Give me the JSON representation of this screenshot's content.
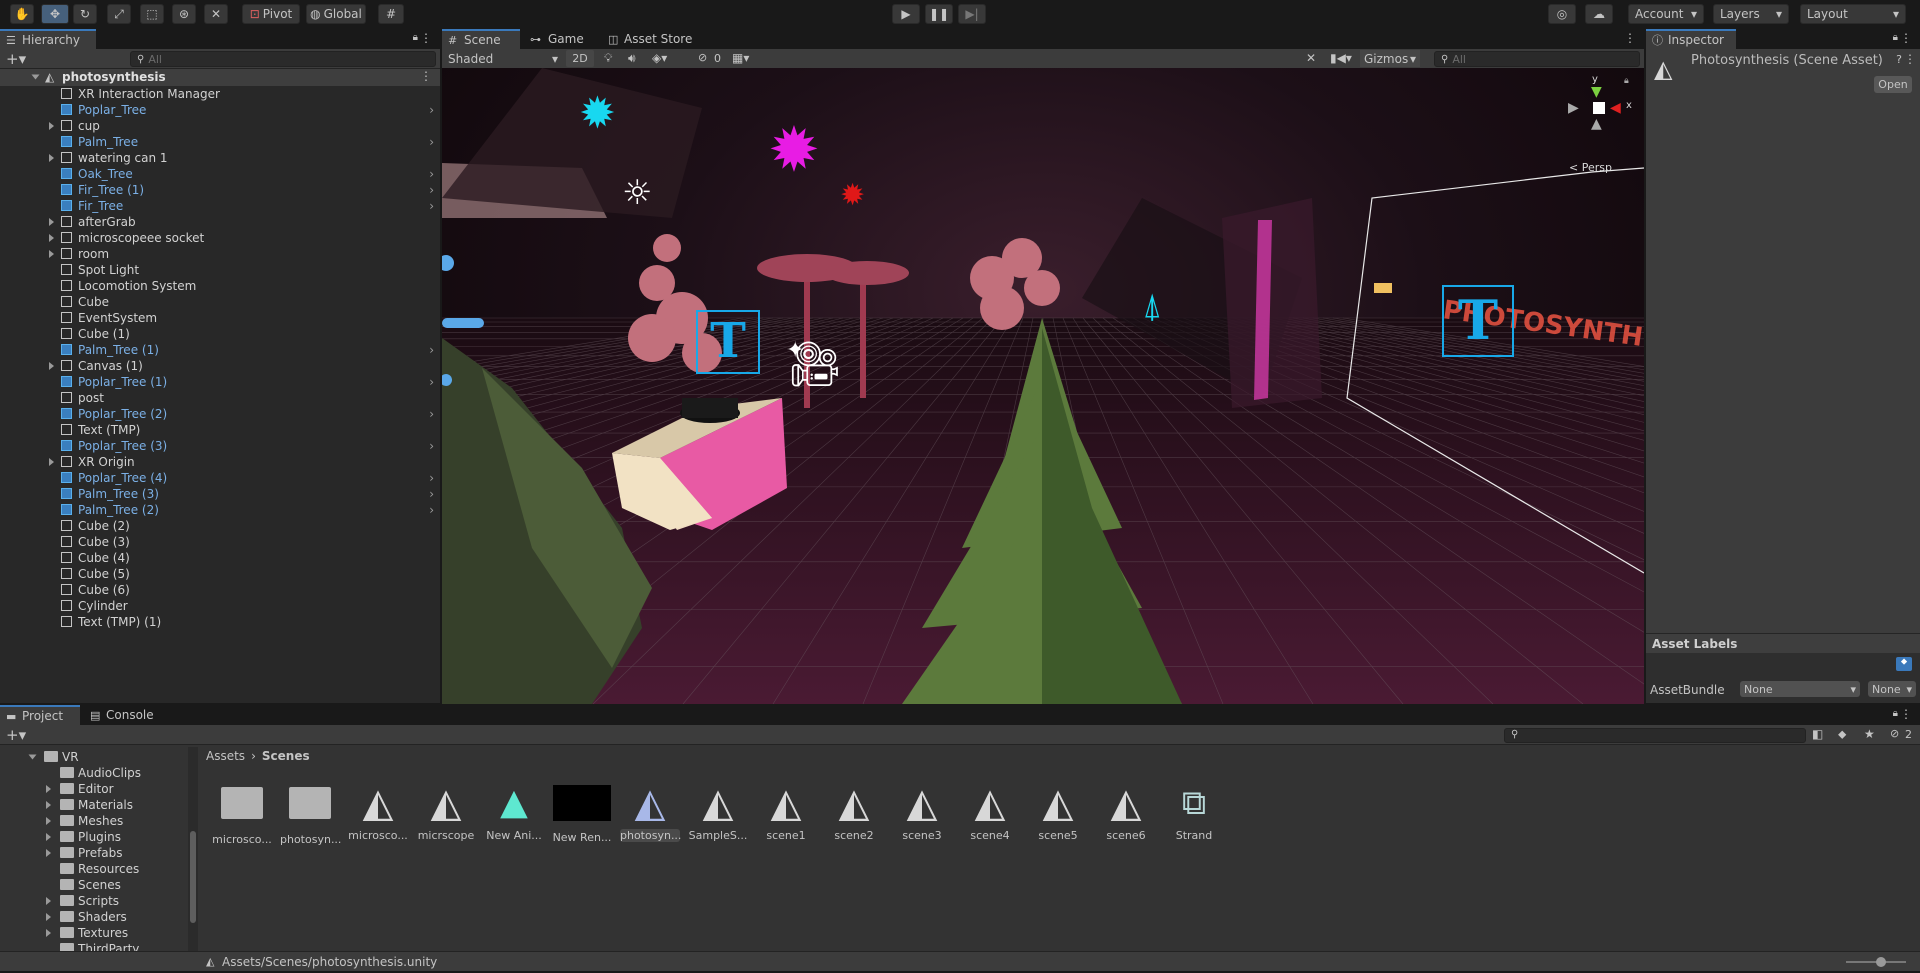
{
  "toolbar": {
    "pivot": "Pivot",
    "global": "Global",
    "account": "Account",
    "layers": "Layers",
    "layout": "Layout"
  },
  "hierarchy": {
    "tab": "Hierarchy",
    "search_placeholder": "All",
    "scene_name": "photosynthesis",
    "items": [
      {
        "label": "XR Interaction Manager",
        "prefab": false,
        "expand": false,
        "arrow": false
      },
      {
        "label": "Poplar_Tree",
        "prefab": true,
        "expand": false,
        "arrow": true
      },
      {
        "label": "cup",
        "prefab": false,
        "expand": true,
        "arrow": false
      },
      {
        "label": "Palm_Tree",
        "prefab": true,
        "expand": false,
        "arrow": true
      },
      {
        "label": "watering can 1",
        "prefab": false,
        "expand": true,
        "arrow": false
      },
      {
        "label": "Oak_Tree",
        "prefab": true,
        "expand": false,
        "arrow": true
      },
      {
        "label": "Fir_Tree (1)",
        "prefab": true,
        "expand": false,
        "arrow": true
      },
      {
        "label": "Fir_Tree",
        "prefab": true,
        "expand": false,
        "arrow": true
      },
      {
        "label": "afterGrab",
        "prefab": false,
        "expand": true,
        "arrow": false
      },
      {
        "label": "microscopeee socket",
        "prefab": false,
        "expand": true,
        "arrow": false
      },
      {
        "label": "room",
        "prefab": false,
        "expand": true,
        "arrow": false
      },
      {
        "label": "Spot Light",
        "prefab": false,
        "expand": false,
        "arrow": false
      },
      {
        "label": "Locomotion System",
        "prefab": false,
        "expand": false,
        "arrow": false
      },
      {
        "label": "Cube",
        "prefab": false,
        "expand": false,
        "arrow": false
      },
      {
        "label": "EventSystem",
        "prefab": false,
        "expand": false,
        "arrow": false
      },
      {
        "label": "Cube (1)",
        "prefab": false,
        "expand": false,
        "arrow": false
      },
      {
        "label": "Palm_Tree (1)",
        "prefab": true,
        "expand": false,
        "arrow": true
      },
      {
        "label": "Canvas (1)",
        "prefab": false,
        "expand": true,
        "arrow": false
      },
      {
        "label": "Poplar_Tree (1)",
        "prefab": true,
        "expand": false,
        "arrow": true
      },
      {
        "label": "post",
        "prefab": false,
        "expand": false,
        "arrow": false
      },
      {
        "label": "Poplar_Tree (2)",
        "prefab": true,
        "expand": false,
        "arrow": true
      },
      {
        "label": "Text (TMP)",
        "prefab": false,
        "expand": false,
        "arrow": false
      },
      {
        "label": "Poplar_Tree (3)",
        "prefab": true,
        "expand": false,
        "arrow": true
      },
      {
        "label": "XR Origin",
        "prefab": false,
        "expand": true,
        "arrow": false
      },
      {
        "label": "Poplar_Tree (4)",
        "prefab": true,
        "expand": false,
        "arrow": true
      },
      {
        "label": "Palm_Tree (3)",
        "prefab": true,
        "expand": false,
        "arrow": true
      },
      {
        "label": "Palm_Tree (2)",
        "prefab": true,
        "expand": false,
        "arrow": true
      },
      {
        "label": "Cube (2)",
        "prefab": false,
        "expand": false,
        "arrow": false
      },
      {
        "label": "Cube (3)",
        "prefab": false,
        "expand": false,
        "arrow": false
      },
      {
        "label": "Cube (4)",
        "prefab": false,
        "expand": false,
        "arrow": false
      },
      {
        "label": "Cube (5)",
        "prefab": false,
        "expand": false,
        "arrow": false
      },
      {
        "label": "Cube (6)",
        "prefab": false,
        "expand": false,
        "arrow": false
      },
      {
        "label": "Cylinder",
        "prefab": false,
        "expand": false,
        "arrow": false
      },
      {
        "label": "Text (TMP) (1)",
        "prefab": false,
        "expand": false,
        "arrow": false
      }
    ]
  },
  "scene_view": {
    "tabs": [
      "Scene",
      "Game",
      "Asset Store"
    ],
    "shading": "Shaded",
    "mode_2d": "2D",
    "hidden_count": "0",
    "gizmos": "Gizmos",
    "search_placeholder": "All",
    "persp": "< Persp",
    "axis_y": "y",
    "axis_x": "x",
    "sign_text": "PHOTOSYNTHESIS",
    "text_icon": "T"
  },
  "inspector": {
    "tab": "Inspector",
    "title": "Photosynthesis (Scene Asset)",
    "open": "Open",
    "asset_labels": "Asset Labels",
    "asset_bundle": "AssetBundle",
    "bundle_value": "None",
    "variant_value": "None"
  },
  "project": {
    "tabs": [
      "Project",
      "Console"
    ],
    "hidden_count": "2",
    "tree": [
      {
        "label": "VR",
        "level": 1,
        "expand": true
      },
      {
        "label": "AudioClips",
        "level": 2,
        "expand": false
      },
      {
        "label": "Editor",
        "level": 2,
        "expand": true
      },
      {
        "label": "Materials",
        "level": 2,
        "expand": true
      },
      {
        "label": "Meshes",
        "level": 2,
        "expand": true
      },
      {
        "label": "Plugins",
        "level": 2,
        "expand": true
      },
      {
        "label": "Prefabs",
        "level": 2,
        "expand": true
      },
      {
        "label": "Resources",
        "level": 2,
        "expand": false
      },
      {
        "label": "Scenes",
        "level": 2,
        "expand": false
      },
      {
        "label": "Scripts",
        "level": 2,
        "expand": true
      },
      {
        "label": "Shaders",
        "level": 2,
        "expand": true
      },
      {
        "label": "Textures",
        "level": 2,
        "expand": true
      },
      {
        "label": "ThirdParty",
        "level": 2,
        "expand": false
      },
      {
        "label": "Resources",
        "level": 0,
        "expand": false
      }
    ],
    "breadcrumb": [
      "Assets",
      "Scenes"
    ],
    "assets": [
      {
        "label": "microsco...",
        "kind": "folder"
      },
      {
        "label": "photosyn...",
        "kind": "folder"
      },
      {
        "label": "microsco...",
        "kind": "unity"
      },
      {
        "label": "micrscope",
        "kind": "unity"
      },
      {
        "label": "New Ani...",
        "kind": "anim"
      },
      {
        "label": "New Ren...",
        "kind": "render"
      },
      {
        "label": "photosyn...",
        "kind": "unity-selected"
      },
      {
        "label": "SampleS...",
        "kind": "unity"
      },
      {
        "label": "scene1",
        "kind": "unity"
      },
      {
        "label": "scene2",
        "kind": "unity"
      },
      {
        "label": "scene3",
        "kind": "unity"
      },
      {
        "label": "scene4",
        "kind": "unity"
      },
      {
        "label": "scene5",
        "kind": "unity"
      },
      {
        "label": "scene6",
        "kind": "unity"
      },
      {
        "label": "Strand",
        "kind": "graph"
      }
    ],
    "status_path": "Assets/Scenes/photosynthesis.unity"
  },
  "colors": {
    "accent": "#3a79bb",
    "prefab": "#7bb0e6",
    "cyan_light": "#18d8f0",
    "magenta_light": "#e81ce4",
    "red_light": "#e01818"
  }
}
